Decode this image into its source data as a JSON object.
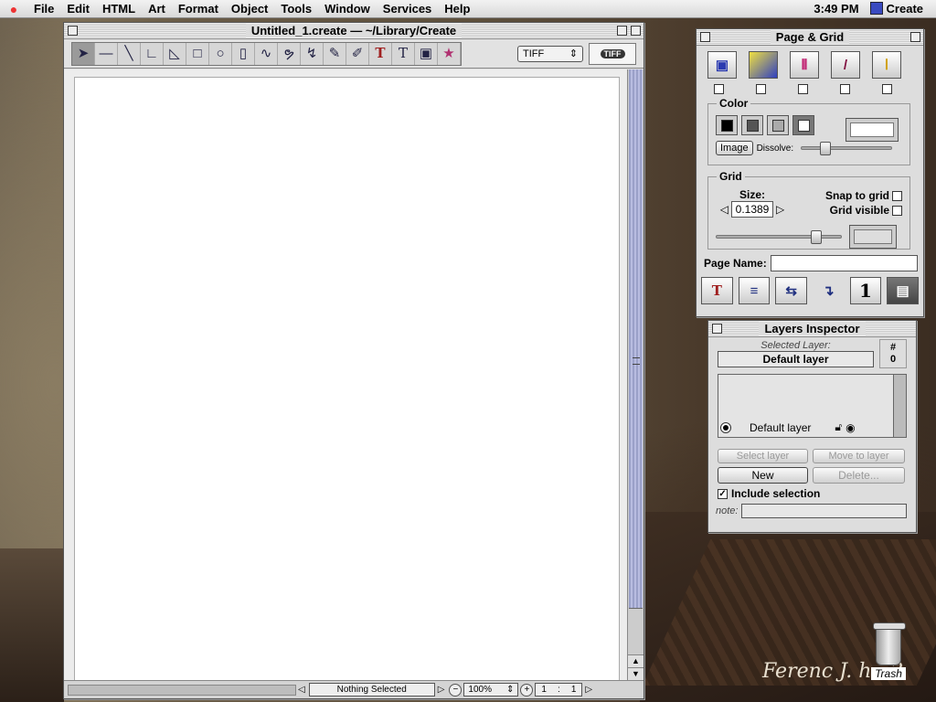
{
  "menubar": {
    "items": [
      "File",
      "Edit",
      "HTML",
      "Art",
      "Format",
      "Object",
      "Tools",
      "Window",
      "Services",
      "Help"
    ],
    "clock": "3:49 PM",
    "app_name": "Create"
  },
  "document": {
    "title": "Untitled_1.create — ~/Library/Create",
    "format_popup": "TIFF",
    "tiff_badge": "TIFF",
    "status": "Nothing Selected",
    "zoom": "100%",
    "page_current": "1",
    "page_total": "1",
    "page_separator": ":"
  },
  "page_grid": {
    "title": "Page & Grid",
    "color_label": "Color",
    "image_button": "Image",
    "dissolve_label": "Dissolve:",
    "grid_label": "Grid",
    "size_label": "Size:",
    "size_value": "0.1389",
    "snap_label": "Snap to grid",
    "grid_visible_label": "Grid visible",
    "page_name_label": "Page Name:",
    "page_name_value": "",
    "bottom_number": "1"
  },
  "layers": {
    "title": "Layers Inspector",
    "selected_label": "Selected Layer:",
    "selected_value": "Default layer",
    "count_label": "#",
    "count_value": "0",
    "list_item": "Default layer",
    "select_layer": "Select layer",
    "move_to_layer": "Move to layer",
    "new": "New",
    "delete": "Delete...",
    "include_selection": "Include selection",
    "note_label": "note:"
  },
  "desktop": {
    "trash_label": "Trash",
    "signature": "Ferenc J. h...2"
  },
  "colors": {
    "accent_blue": "#3a4ac0",
    "scroll_thumb": "#9aa0c8"
  }
}
